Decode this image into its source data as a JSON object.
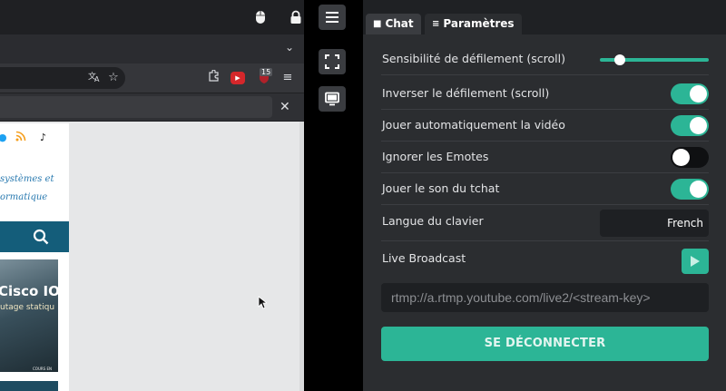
{
  "panel": {
    "tabs": [
      {
        "label": "Chat",
        "icon": "chat-bubble-icon",
        "active": false
      },
      {
        "label": "Paramètres",
        "icon": "sliders-icon",
        "active": true
      }
    ],
    "settings": {
      "scroll_sensitivity": {
        "label": "Sensibilité de défilement (scroll)",
        "value": 0.15
      },
      "invert_scroll": {
        "label": "Inverser le défilement (scroll)",
        "on": true
      },
      "autoplay_video": {
        "label": "Jouer automatiquement la vidéo",
        "on": true
      },
      "ignore_emotes": {
        "label": "Ignorer les Emotes",
        "on": false
      },
      "chat_sound": {
        "label": "Jouer le son du tchat",
        "on": true
      },
      "keyboard_language": {
        "label": "Langue du clavier",
        "value": "French"
      },
      "live_broadcast": {
        "label": "Live Broadcast"
      }
    },
    "rtmp_placeholder": "rtmp://a.rtmp.youtube.com/live2/<stream-key>",
    "disconnect_label": "SE DÉCONNECTER",
    "accent_color": "#2cb596"
  },
  "toolbar": {
    "icons": [
      "mouse-icon",
      "lock-icon",
      "menu-icon",
      "fullscreen-icon",
      "monitor-icon"
    ]
  },
  "remote": {
    "extension_badge": "15",
    "site_text_line1": "systèmes et",
    "site_text_line2": "ormatique",
    "banner_title": "Cisco IOS",
    "banner_subtitle": "utage statiqu",
    "banner_footer": "COURS EN"
  }
}
